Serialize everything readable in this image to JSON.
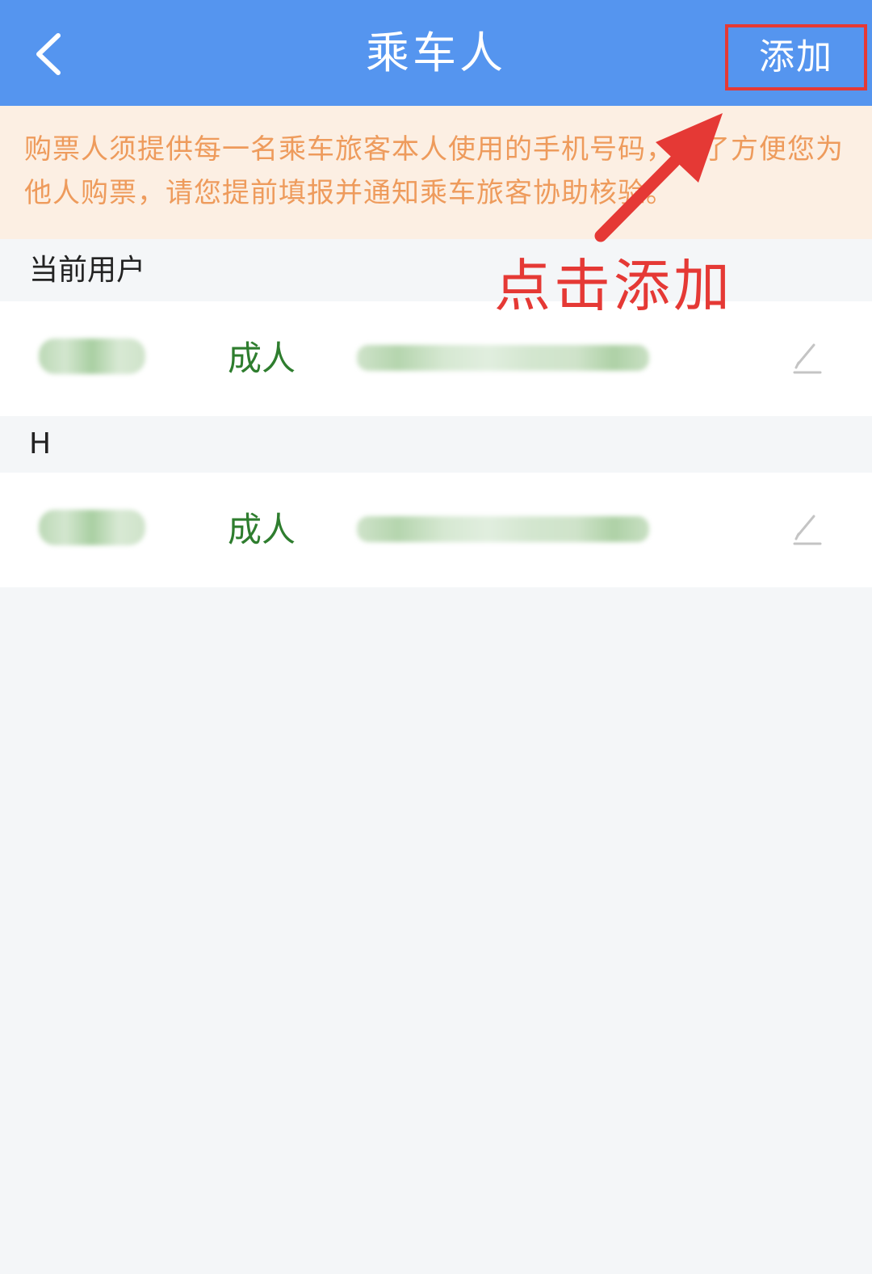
{
  "header": {
    "title": "乘车人",
    "add_label": "添加"
  },
  "notice": {
    "text": "购票人须提供每一名乘车旅客本人使用的手机号码，为了方便您为他人购票，请您提前填报并通知乘车旅客协助核验。"
  },
  "sections": [
    {
      "title": "当前用户",
      "passengers": [
        {
          "type": "成人"
        }
      ]
    },
    {
      "title": "H",
      "passengers": [
        {
          "type": "成人"
        }
      ]
    }
  ],
  "annotation": {
    "text": "点击添加"
  },
  "colors": {
    "header_bg": "#5595ef",
    "notice_bg": "#fcefe3",
    "notice_text": "#ee9b5c",
    "passenger_type": "#2e7d2e",
    "annotation": "#e53935"
  },
  "icons": {
    "back": "chevron-left-icon",
    "edit": "pencil-icon"
  }
}
